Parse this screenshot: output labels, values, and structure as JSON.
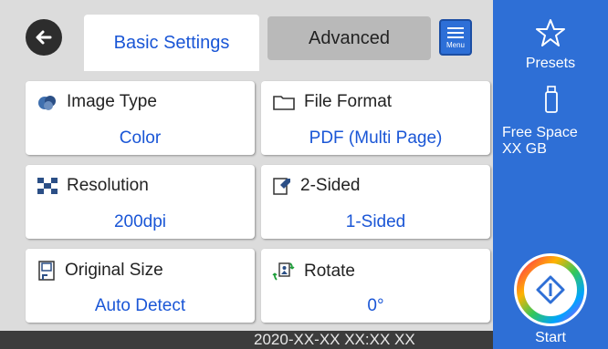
{
  "header": {
    "tabs": [
      {
        "label": "Basic Settings",
        "active": true
      },
      {
        "label": "Advanced",
        "active": false
      }
    ],
    "menu_label": "Menu",
    "icons": {
      "back": "back-arrow-icon",
      "menu": "menu-icon"
    }
  },
  "settings": [
    {
      "title": "Image Type",
      "value": "Color",
      "icon": "image-type-icon"
    },
    {
      "title": "File Format",
      "value": "PDF (Multi Page)",
      "icon": "folder-icon"
    },
    {
      "title": "Resolution",
      "value": "200dpi",
      "icon": "resolution-icon"
    },
    {
      "title": "2-Sided",
      "value": "1-Sided",
      "icon": "two-sided-icon"
    },
    {
      "title": "Original Size",
      "value": "Auto Detect",
      "icon": "original-size-icon"
    },
    {
      "title": "Rotate",
      "value": "0°",
      "icon": "rotate-icon"
    }
  ],
  "sidebar": {
    "presets_label": "Presets",
    "free_space_label": "Free Space",
    "free_space_value": "XX GB",
    "start_label": "Start",
    "icons": {
      "presets": "star-icon",
      "storage": "usb-drive-icon",
      "start": "start-icon"
    }
  },
  "status": {
    "datetime": "2020-XX-XX XX:XX XX"
  },
  "colors": {
    "accent": "#1a56d6",
    "sidebar": "#2e6fd6",
    "background": "#dcdcdc",
    "statusbar": "#3c3c3c"
  }
}
